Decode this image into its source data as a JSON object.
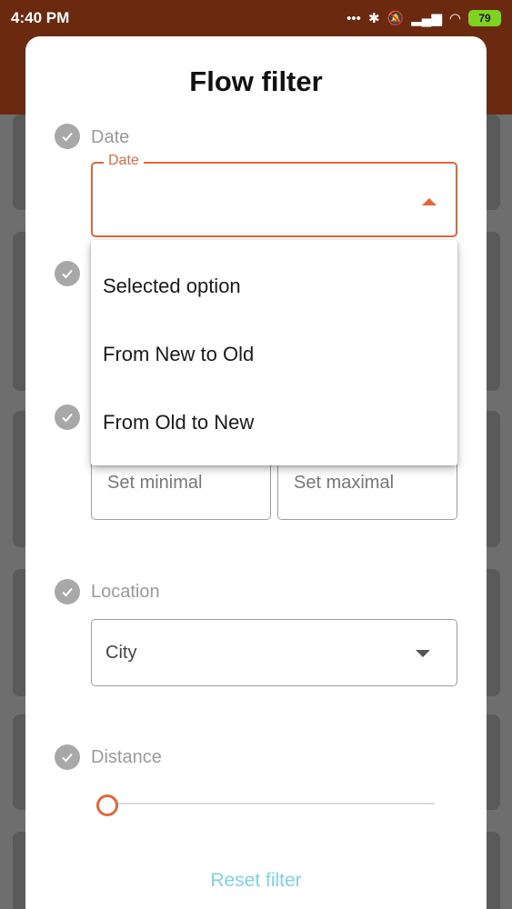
{
  "status_bar": {
    "time": "4:40 PM",
    "battery": "79"
  },
  "sheet": {
    "title": "Flow filter",
    "date": {
      "label": "Date",
      "field_label": "Date"
    },
    "dropdown": {
      "options": [
        "Selected option",
        "From New to Old",
        "From Old to New"
      ]
    },
    "range": {
      "min_placeholder": "Set minimal",
      "max_placeholder": "Set maximal"
    },
    "location": {
      "label": "Location",
      "value": "City"
    },
    "distance": {
      "label": "Distance",
      "value": 0
    },
    "reset_label": "Reset filter"
  },
  "colors": {
    "accent": "#e0683a",
    "reset": "#7fd3e4",
    "header": "#6b2a10"
  }
}
